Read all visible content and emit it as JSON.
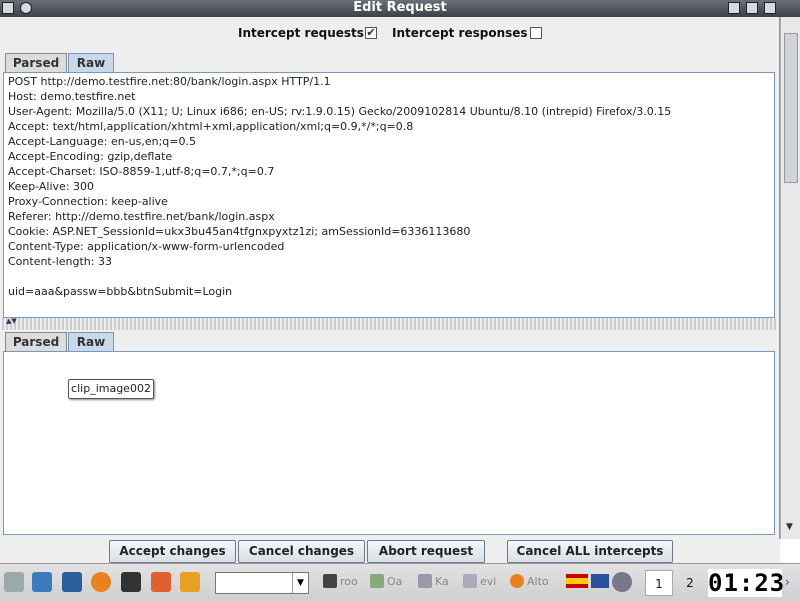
{
  "window": {
    "title": "Edit Request",
    "controls": [
      "minimize",
      "maximize",
      "close"
    ]
  },
  "intercept": {
    "requests_label": "Intercept requests :",
    "requests_checked": true,
    "responses_label": "Intercept responses :",
    "responses_checked": false
  },
  "request_panel": {
    "tabs": [
      {
        "label": "Parsed",
        "active": false
      },
      {
        "label": "Raw",
        "active": true
      }
    ],
    "raw_text": "POST http://demo.testfire.net:80/bank/login.aspx HTTP/1.1\nHost: demo.testfire.net\nUser-Agent: Mozilla/5.0 (X11; U; Linux i686; en-US; rv:1.9.0.15) Gecko/2009102814 Ubuntu/8.10 (intrepid) Firefox/3.0.15\nAccept: text/html,application/xhtml+xml,application/xml;q=0.9,*/*;q=0.8\nAccept-Language: en-us,en;q=0.5\nAccept-Encoding: gzip,deflate\nAccept-Charset: ISO-8859-1,utf-8;q=0.7,*;q=0.7\nKeep-Alive: 300\nProxy-Connection: keep-alive\nReferer: http://demo.testfire.net/bank/login.aspx\nCookie: ASP.NET_SessionId=ukx3bu45an4tfgnxpyxtz1zi; amSessionId=6336113680\nContent-Type: application/x-www-form-urlencoded\nContent-length: 33\n\nuid=aaa&passw=bbb&btnSubmit=Login"
  },
  "response_panel": {
    "tabs": [
      {
        "label": "Parsed",
        "active": false
      },
      {
        "label": "Raw",
        "active": true
      }
    ],
    "tooltip": "clip_image002"
  },
  "buttons": {
    "accept": "Accept changes",
    "cancel": "Cancel changes",
    "abort": "Abort request",
    "cancel_all": "Cancel ALL intercepts"
  },
  "taskbar": {
    "tasks": [
      "roo",
      "Oa",
      "Ka",
      "evi",
      "Alto"
    ],
    "workspaces": [
      "1",
      "2"
    ],
    "active_workspace": "1",
    "clock": "01:23"
  },
  "colors": {
    "titlebar": "#3c4048",
    "tab_active": "#c8d9ea",
    "textarea_border": "#7a99b9"
  }
}
